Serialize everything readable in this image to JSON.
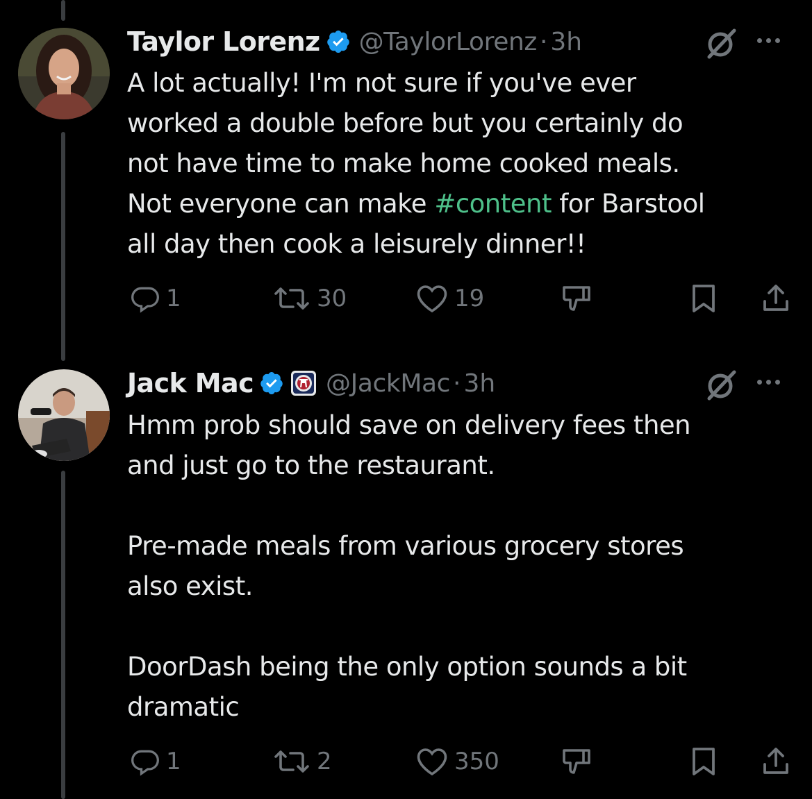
{
  "tweets": [
    {
      "name": "Taylor Lorenz",
      "handle": "@TaylorLorenz",
      "separator": "·",
      "time": "3h",
      "text_before": "A lot actually! I'm not sure if you've ever\nworked a double before but you certainly do\nnot have time to make home cooked meals.\nNot everyone can make ",
      "hashtag": "#content",
      "text_after": " for Barstool\nall day then cook a leisurely dinner!!",
      "actions": {
        "replies": "1",
        "reposts": "30",
        "likes": "19"
      }
    },
    {
      "name": "Jack Mac",
      "handle": "@JackMac",
      "separator": "·",
      "time": "3h",
      "text": "Hmm prob should save on delivery fees then\nand just go to the restaurant.\n\nPre-made meals from various grocery stores\nalso exist.\n\nDoorDash being the only option sounds a bit\ndramatic",
      "actions": {
        "replies": "1",
        "reposts": "2",
        "likes": "350"
      }
    }
  ],
  "colors": {
    "background": "#000000",
    "text": "#e7e9ea",
    "muted": "#71767b",
    "verified": "#1d9bf0",
    "hashtag": "#4ec08a"
  },
  "icons": [
    "verified-badge-icon",
    "affiliate-badge-icon",
    "grok-icon",
    "more-icon",
    "reply-icon",
    "repost-icon",
    "like-icon",
    "downvote-icon",
    "bookmark-icon",
    "share-icon"
  ]
}
